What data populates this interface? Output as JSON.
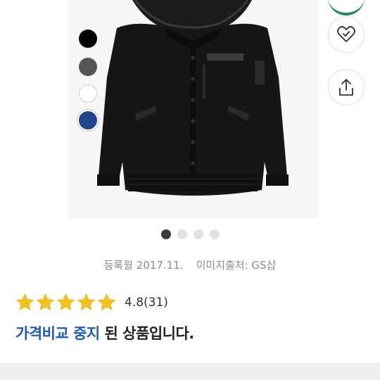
{
  "product": {
    "image": {
      "alt": "black hooded padded bomber jacket with fur trim"
    },
    "swatches": [
      {
        "name": "black",
        "color": "#000000"
      },
      {
        "name": "gray",
        "color": "#555555"
      },
      {
        "name": "white",
        "color": "#ffffff"
      },
      {
        "name": "navy",
        "color": "#22448f"
      }
    ],
    "pager": {
      "total": 4,
      "active": 1
    },
    "meta": {
      "registered": "등록월 2017.11.",
      "image_source": "이미지출처: GS샵"
    },
    "rating": {
      "stars": 5,
      "value": "4.8",
      "count": "(31)",
      "star_color": "#f5c21b"
    },
    "notice": {
      "highlight": "가격비교 중지",
      "rest": " 된 상품입니다."
    }
  },
  "actions": {
    "favorite_icon": "heart-check-icon",
    "share_icon": "share-icon"
  },
  "colors": {
    "accent_blue": "#1e58c8",
    "accent_green": "#1f8a6a"
  }
}
